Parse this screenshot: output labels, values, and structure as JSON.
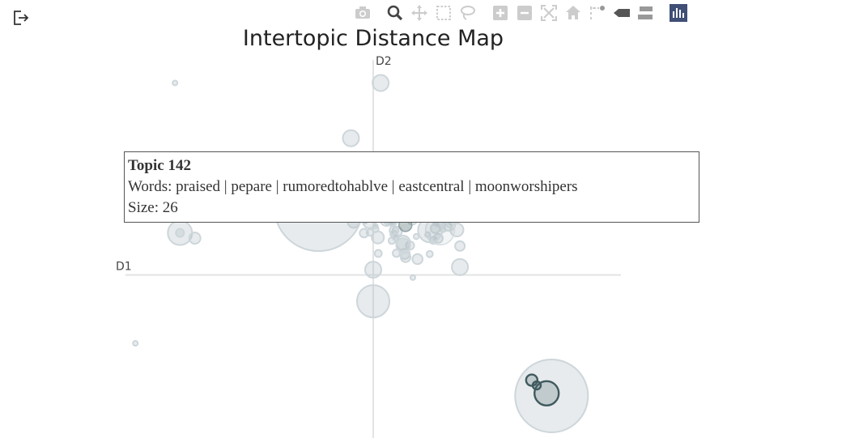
{
  "chart_data": {
    "type": "scatter",
    "title": "Intertopic Distance Map",
    "xlabel": "D1",
    "ylabel": "D2",
    "xlim": [
      -10,
      10
    ],
    "ylim": [
      -6.2,
      8.3
    ],
    "grid": false,
    "legend": "none",
    "points": [
      {
        "x": -8.0,
        "y": 7.3,
        "size": 3,
        "highlight": false
      },
      {
        "x": 0.3,
        "y": 7.3,
        "size": 10,
        "highlight": false
      },
      {
        "x": -0.9,
        "y": 5.2,
        "size": 10,
        "highlight": false
      },
      {
        "x": -2.2,
        "y": 2.6,
        "size": 55,
        "highlight": false
      },
      {
        "x": -2.2,
        "y": 2.6,
        "size": 8,
        "highlight": false
      },
      {
        "x": 2.3,
        "y": 1.7,
        "size": 15,
        "highlight": false
      },
      {
        "x": -7.8,
        "y": 1.6,
        "size": 15,
        "highlight": false
      },
      {
        "x": -7.8,
        "y": 1.6,
        "size": 5,
        "highlight": false
      },
      {
        "x": -7.2,
        "y": 1.4,
        "size": 7,
        "highlight": false
      },
      {
        "x": 3.5,
        "y": 1.1,
        "size": 6,
        "highlight": false
      },
      {
        "x": 3.5,
        "y": 0.3,
        "size": 10,
        "highlight": false
      },
      {
        "x": 0.0,
        "y": 0.2,
        "size": 10,
        "highlight": false
      },
      {
        "x": 1.6,
        "y": -0.1,
        "size": 3,
        "highlight": false
      },
      {
        "x": 0.0,
        "y": -1.0,
        "size": 20,
        "highlight": false
      },
      {
        "x": -9.6,
        "y": -2.6,
        "size": 3,
        "highlight": false
      },
      {
        "x": 7.2,
        "y": -4.6,
        "size": 45,
        "highlight": false
      },
      {
        "x": 7.0,
        "y": -4.5,
        "size": 15,
        "highlight": true
      },
      {
        "x": 6.4,
        "y": -4.0,
        "size": 7,
        "highlight": true
      },
      {
        "x": 6.6,
        "y": -4.2,
        "size": 5,
        "highlight": true
      }
    ],
    "cluster": {
      "x": 1.3,
      "y": 2.0,
      "count": 70
    }
  },
  "tooltip": {
    "title": "Topic 142",
    "words": "Words: praised | pepare | rumoredtohablve | eastcentral | moonworshipers",
    "size": "Size: 26"
  },
  "modebar": {
    "buttons": [
      "camera-icon",
      "zoom-icon",
      "pan-icon",
      "box-select-icon",
      "lasso-icon",
      "zoom-in-icon",
      "zoom-out-icon",
      "autoscale-icon",
      "reset-axes-icon",
      "spike-lines-icon",
      "hover-closest-icon",
      "hover-compare-icon",
      "plotly-logo-icon"
    ],
    "active": "zoom-icon"
  }
}
